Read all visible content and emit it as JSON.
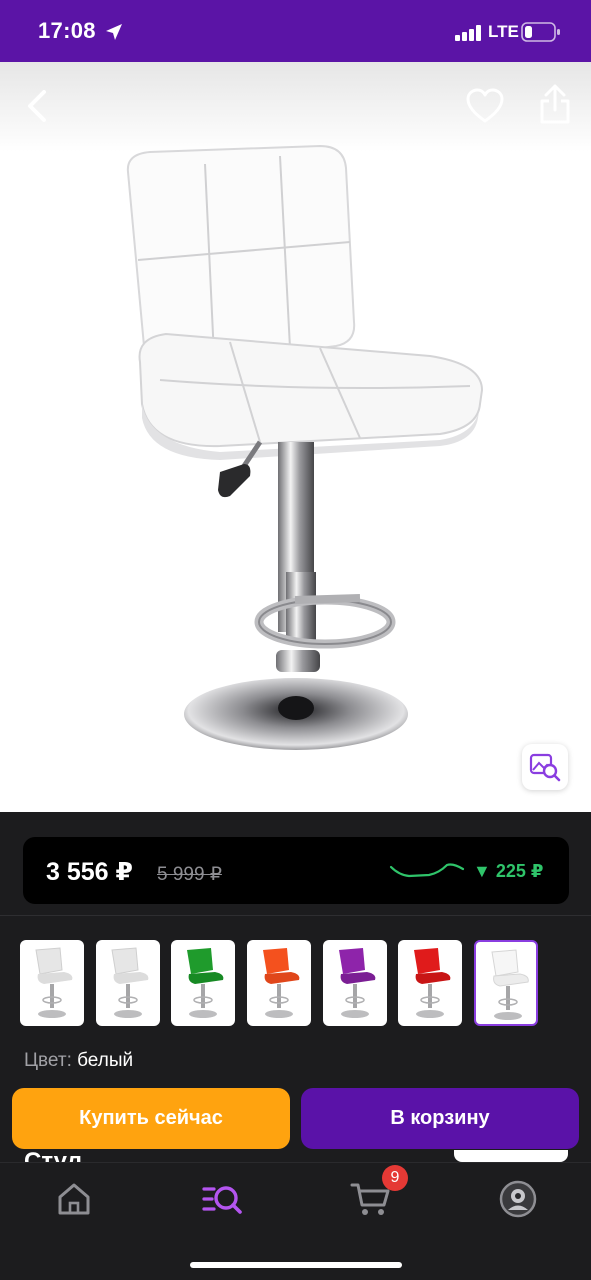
{
  "status_bar": {
    "time": "17:08",
    "network": "LTE",
    "location_icon": "location-arrow-icon",
    "signal_icon": "signal-bars-icon",
    "battery_icon": "battery-low-icon"
  },
  "header": {
    "back_icon": "chevron-left-icon",
    "favorite_icon": "heart-icon",
    "share_icon": "share-icon"
  },
  "product_image": {
    "description_icon": "bar-stool-white",
    "visual_search_icon": "image-search-icon"
  },
  "price": {
    "current": "3 556 ₽",
    "old": "5 999 ₽",
    "drop": "▼ 225 ₽",
    "drop_color": "#2fc46a"
  },
  "colors": {
    "label": "Цвет:",
    "value": "белый",
    "thumbnails": [
      {
        "name": "white-1",
        "color": "#e8e8e8"
      },
      {
        "name": "white-2",
        "color": "#e8e8e8"
      },
      {
        "name": "green",
        "color": "#1f9b2c"
      },
      {
        "name": "orange",
        "color": "#f4511e"
      },
      {
        "name": "purple",
        "color": "#8e24aa"
      },
      {
        "name": "red",
        "color": "#e01b1b"
      },
      {
        "name": "white-selected",
        "color": "#f4f4f4"
      }
    ]
  },
  "actions": {
    "buy_now": "Купить сейчас",
    "add_to_cart": "В корзину",
    "buy_now_color": "#ffa30f",
    "add_to_cart_color": "#5a12a8"
  },
  "product_title_peek": "Стул",
  "tabbar": {
    "home_icon": "home-icon",
    "catalog_icon": "search-list-icon",
    "cart_icon": "cart-icon",
    "profile_icon": "avatar-icon",
    "cart_badge": "9",
    "active_color": "#b455f0"
  }
}
